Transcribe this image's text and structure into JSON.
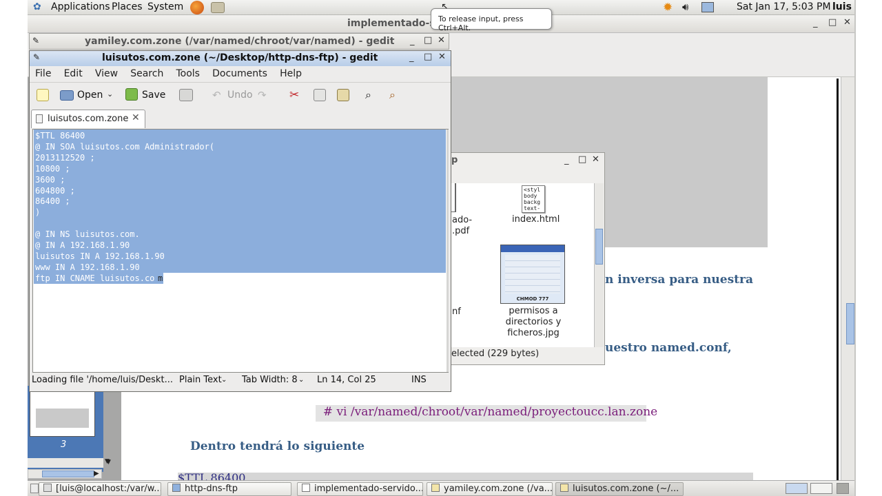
{
  "top_panel": {
    "applications": "Applications",
    "places": "Places",
    "system": "System",
    "datetime": "Sat Jan 17,  5:03 PM",
    "user": "luis"
  },
  "tooltip": "To release input, press Ctrl+Alt.",
  "doc_window": {
    "title": "implementado-se",
    "line1": "n inversa para nuestra",
    "line2": "uestro named.conf,",
    "command": "  # vi /var/named/chroot/var/named/proyectoucc.lan.zone",
    "line3": "Dentro tendrá lo siguiente",
    "page_number": "3",
    "partial_code": "$TTL 86400"
  },
  "nautilus": {
    "title_fragment": "p",
    "file1_name": "index.html",
    "file1_thumb_lines": [
      "<styl",
      "body",
      "backg",
      "text-"
    ],
    "file2_name": "permisos a directorios y ficheros.jpg",
    "file2_thumb_caption": "CHMOD 777",
    "left_frag1": "ado-",
    "left_frag2": ".pdf",
    "left_frag3": "nf",
    "status": "elected (229 bytes)"
  },
  "gedit_back": {
    "title": "yamiley.com.zone (/var/named/chroot/var/named) - gedit"
  },
  "gedit": {
    "title": "luisutos.com.zone (~/Desktop/http-dns-ftp) - gedit",
    "menu": [
      "File",
      "Edit",
      "View",
      "Search",
      "Tools",
      "Documents",
      "Help"
    ],
    "toolbar": {
      "open": "Open",
      "save": "Save",
      "undo": "Undo"
    },
    "tab_label": "luisutos.com.zone",
    "code_lines": [
      "$TTL 86400",
      "@ IN SOA luisutos.com Administrador(",
      "2013112520 ;",
      "10800 ;",
      "3600 ;",
      "604800 ;",
      "86400 ;",
      ")",
      "",
      "@ IN NS luisutos.com.",
      "@ IN A 192.168.1.90",
      "luisutos IN A 192.168.1.90",
      "www IN A 192.168.1.90",
      "ftp IN CNAME luisutos.co"
    ],
    "last_line_tail": "m",
    "status": {
      "message": "Loading file '/home/luis/Deskt...",
      "language": "Plain Text",
      "tab_width": "Tab Width:  8",
      "position": "Ln 14, Col 25",
      "mode": "INS"
    }
  },
  "taskbar": [
    "[luis@localhost:/var/w...",
    "http-dns-ftp",
    "implementado-servido...",
    "yamiley.com.zone (/va...",
    "luisutos.com.zone (~/..."
  ]
}
